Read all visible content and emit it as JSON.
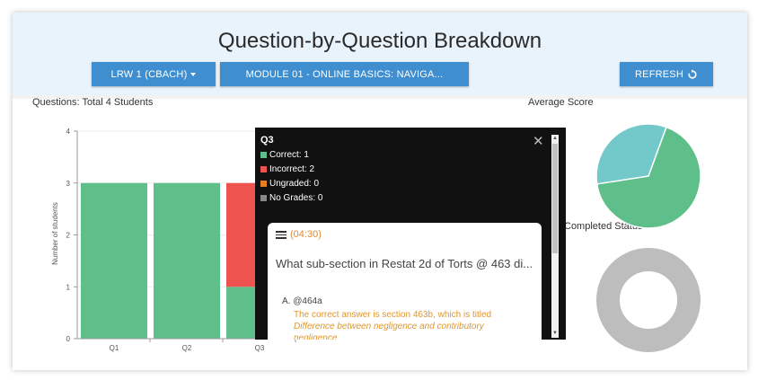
{
  "header": {
    "title": "Question-by-Question Breakdown",
    "course_select": "LRW 1 (CBACH)",
    "module_button": "MODULE 01 - ONLINE BASICS: NAVIGA...",
    "refresh_button": "REFRESH"
  },
  "questions_chart": {
    "title": "Questions: Total 4 Students",
    "ylabel": "Number of students"
  },
  "average_score": {
    "title": "Average Score"
  },
  "completed_status": {
    "title": "Completed Status"
  },
  "popup": {
    "title": "Q3",
    "legend": {
      "correct": "Correct: 1",
      "incorrect": "Incorrect: 2",
      "ungraded": "Ungraded: 0",
      "no_grades": "No Grades: 0"
    },
    "card": {
      "time": "(04:30)",
      "question": "What sub-section in Restat 2d of Torts @ 463 di...",
      "answer": "A. @464a",
      "explanation_prefix": "The correct answer is section 463b, which is titled ",
      "explanation_italic": "Difference between negligence and contributory negligence"
    }
  },
  "colors": {
    "correct": "#5fbf8a",
    "incorrect": "#ef5350",
    "ungraded": "#e67e22",
    "no_grades": "#888888",
    "pie_teal": "#73c9c9",
    "donut": "#bdbdbd",
    "button": "#3f8fd0"
  },
  "chart_data": [
    {
      "type": "bar",
      "title": "Questions: Total 4 Students",
      "ylabel": "Number of students",
      "xlabel": "",
      "categories": [
        "Q1",
        "Q2",
        "Q3"
      ],
      "series": [
        {
          "name": "Correct",
          "values": [
            3,
            3,
            1
          ]
        },
        {
          "name": "Incorrect",
          "values": [
            0,
            0,
            2
          ]
        }
      ],
      "ylim": [
        0,
        4
      ],
      "yticks": [
        "0",
        "1",
        "2",
        "3",
        "4"
      ]
    },
    {
      "type": "pie",
      "title": "Average Score",
      "slices": [
        {
          "value": 0.67,
          "color": "#5fbf8a"
        },
        {
          "value": 0.33,
          "color": "#73c9c9"
        }
      ]
    },
    {
      "type": "pie",
      "title": "Completed Status",
      "slices": [
        {
          "value": 1.0,
          "color": "#bdbdbd"
        }
      ]
    }
  ]
}
